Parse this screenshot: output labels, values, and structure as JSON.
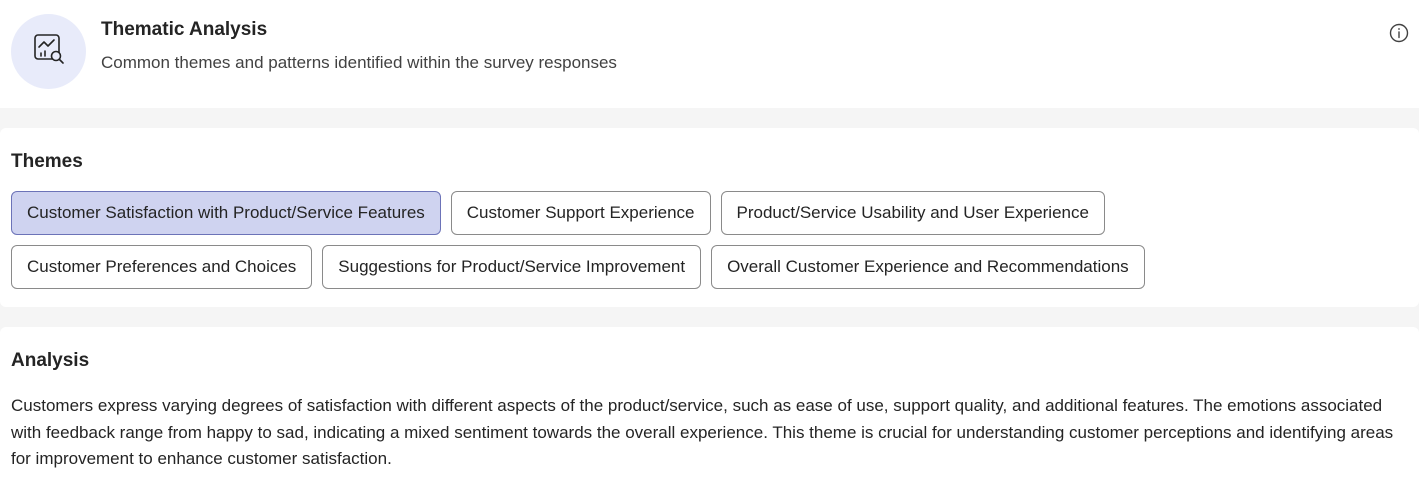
{
  "header": {
    "icon": "chart-search-icon",
    "title": "Thematic Analysis",
    "subtitle": "Common themes and patterns identified within the survey responses",
    "info_icon": "info-icon"
  },
  "themes": {
    "title": "Themes",
    "selected_index": 0,
    "rows": [
      [
        "Customer Satisfaction with Product/Service Features",
        "Customer Support Experience",
        "Product/Service Usability and User Experience"
      ],
      [
        "Customer Preferences and Choices",
        "Suggestions for Product/Service Improvement",
        "Overall Customer Experience and Recommendations"
      ]
    ]
  },
  "analysis": {
    "title": "Analysis",
    "text": "Customers express varying degrees of satisfaction with different aspects of the product/service, such as ease of use, support quality, and additional features. The emotions associated with feedback range from happy to sad, indicating a mixed sentiment towards the overall experience. This theme is crucial for understanding customer perceptions and identifying areas for improvement to enhance customer satisfaction."
  },
  "colors": {
    "icon_bg": "#e8ebfa",
    "selected_chip_bg": "#cfd3f0",
    "selected_chip_border": "#6c73b8"
  }
}
